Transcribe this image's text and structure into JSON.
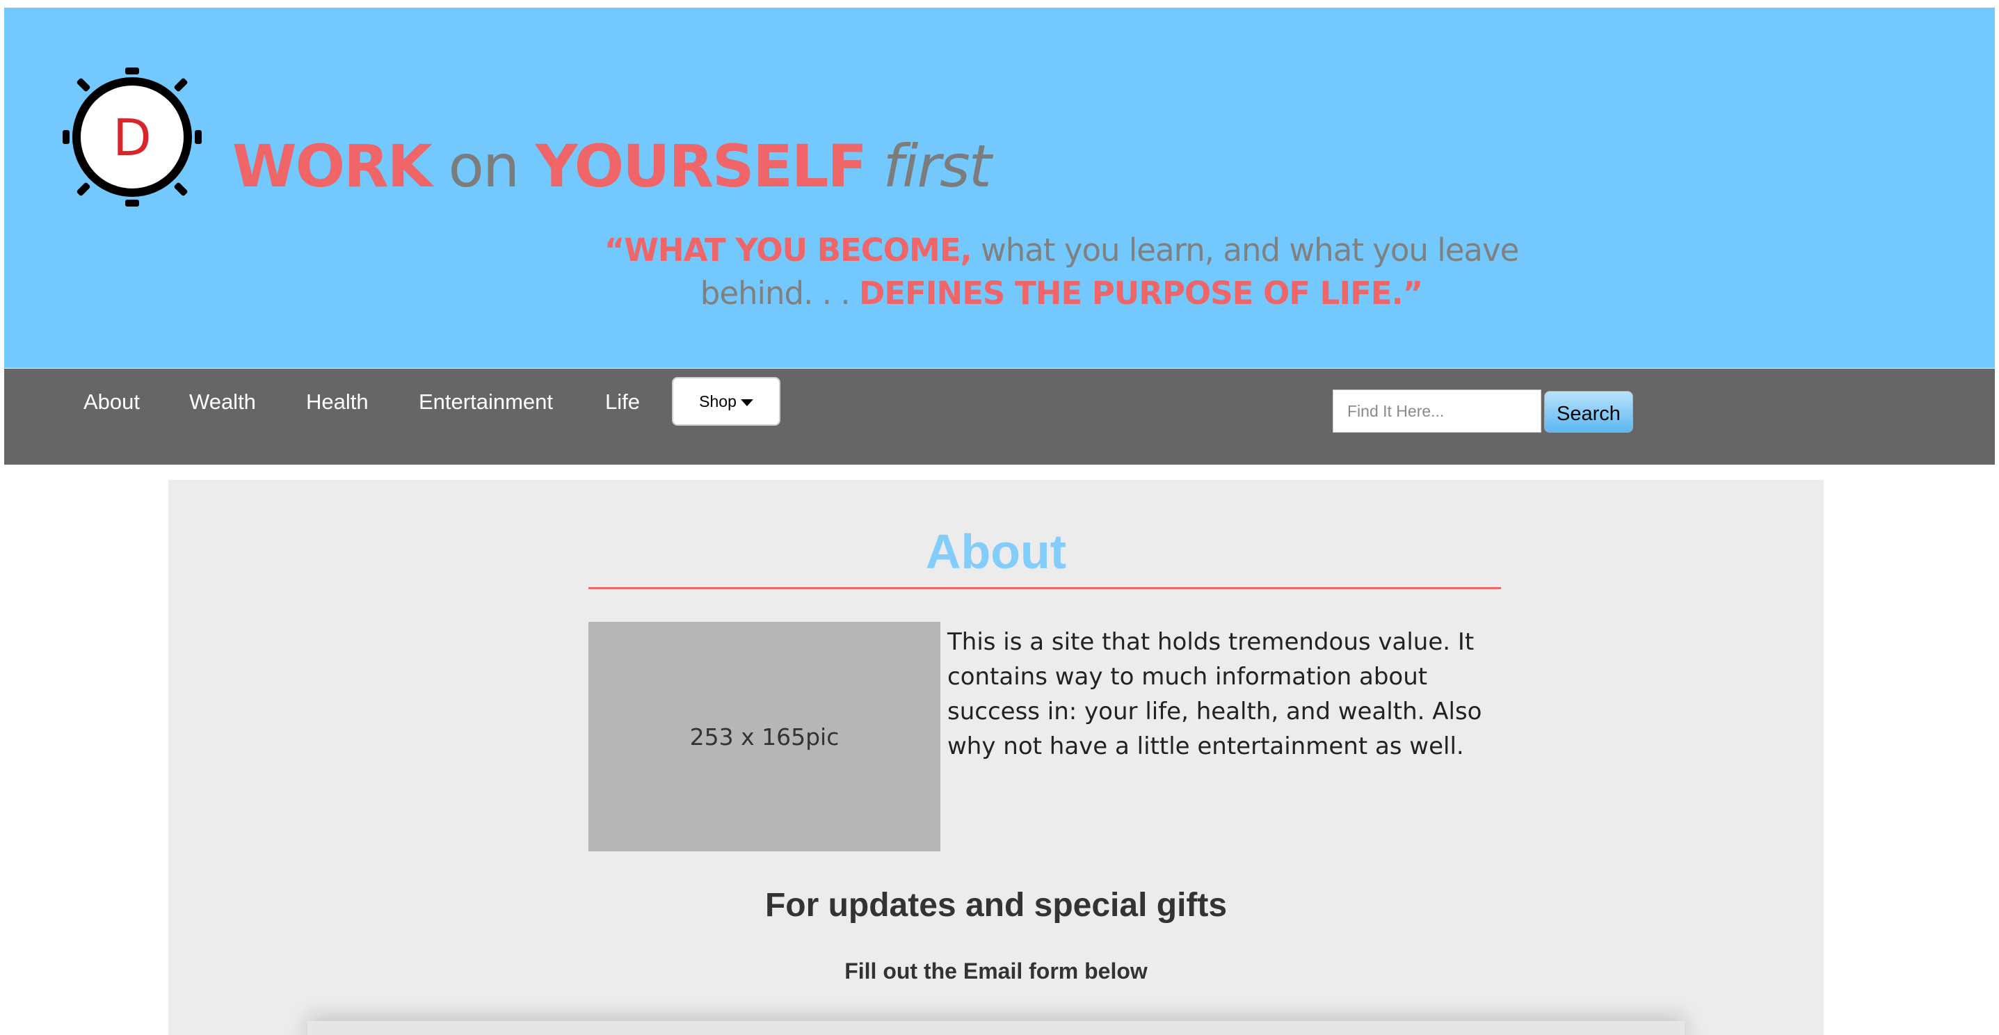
{
  "header": {
    "logo_letter": "D",
    "title_work": "WORK",
    "title_on": "on",
    "title_yourself": "YOURSELF",
    "title_first": "first",
    "quote_part1": "“WHAT YOU BECOME,",
    "quote_part2": "what you learn, and what you leave behind. . .",
    "quote_part3": "DEFINES THE PURPOSE OF LIFE.”"
  },
  "nav": {
    "items": [
      {
        "label": "About"
      },
      {
        "label": "Wealth"
      },
      {
        "label": "Health"
      },
      {
        "label": "Entertainment"
      },
      {
        "label": "Life"
      }
    ],
    "shop_label": "Shop",
    "search_placeholder": "Find It Here...",
    "search_button": "Search"
  },
  "main": {
    "title": "About",
    "image_placeholder": "253 x 165pic",
    "description": "This is a site that holds tremendous value. It contains way to much information about success in: your life, health, and wealth. Also why not have a little entertainment as well.",
    "updates_heading": "For updates and special gifts",
    "email_subheading": "Fill out the Email form below"
  },
  "colors": {
    "header_bg": "#73c8fd",
    "nav_bg": "#666666",
    "accent_red": "#ef6568",
    "about_blue": "#82cdfb",
    "content_bg": "#ececec"
  }
}
